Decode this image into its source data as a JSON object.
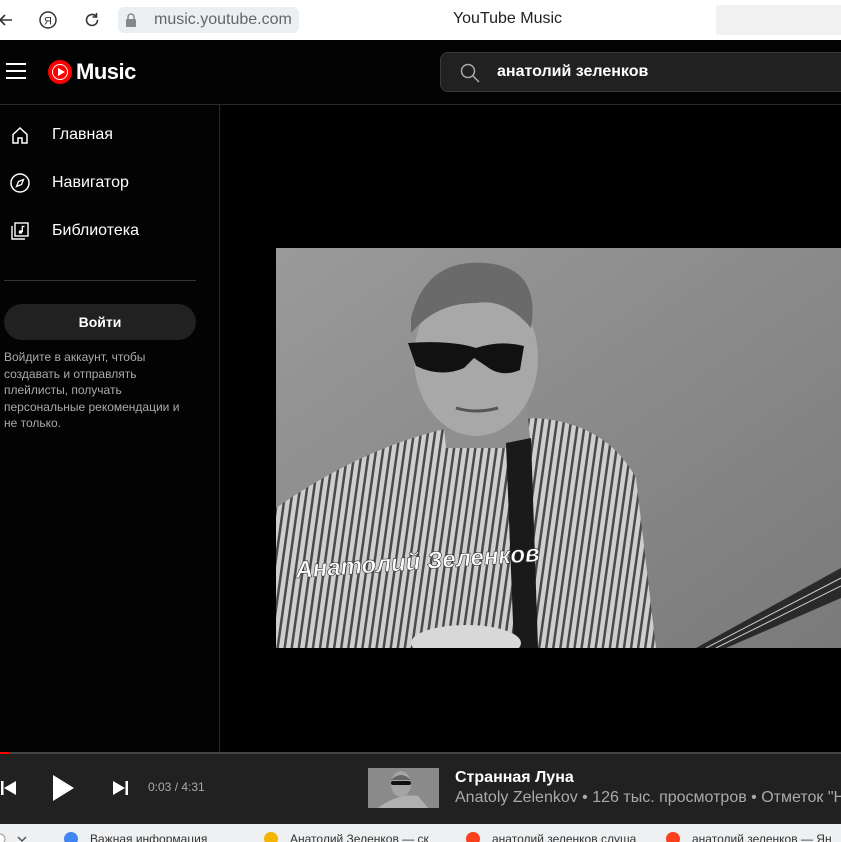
{
  "browser": {
    "url": "music.youtube.com",
    "tab_title": "YouTube Music"
  },
  "header": {
    "logo_text": "Music",
    "search_value": "анатолий зеленков"
  },
  "sidebar": {
    "items": [
      {
        "label": "Главная",
        "icon": "home-icon"
      },
      {
        "label": "Навигатор",
        "icon": "compass-icon"
      },
      {
        "label": "Библиотека",
        "icon": "library-icon"
      }
    ],
    "login_label": "Войти",
    "login_text": "Войдите в аккаунт, чтобы создавать и отправлять плейлисты, получать персональные рекомендации и не только."
  },
  "video": {
    "overlay_text": "Анатолий Зеленков"
  },
  "player": {
    "time": "0:03 / 4:31",
    "progress": 0.011,
    "song_title": "Странная Луна",
    "song_meta": "Anatoly Zelenkov • 126 тыс. просмотров • Отметок \"Н"
  },
  "bottom_tabs": [
    {
      "label": "Важная информация",
      "icon": "google-icon",
      "color": "#4285f4"
    },
    {
      "label": "Анатолий Зеленков — ск",
      "icon": "sun-icon",
      "color": "#f4b400"
    },
    {
      "label": "анатолий зеленков слуша",
      "icon": "yandex-icon",
      "color": "#fc3f1d"
    },
    {
      "label": "анатолий зеленков — Ян",
      "icon": "yandex-icon",
      "color": "#fc3f1d"
    }
  ],
  "colors": {
    "accent": "#ff0000",
    "background": "#030303",
    "player_bg": "#212121"
  }
}
